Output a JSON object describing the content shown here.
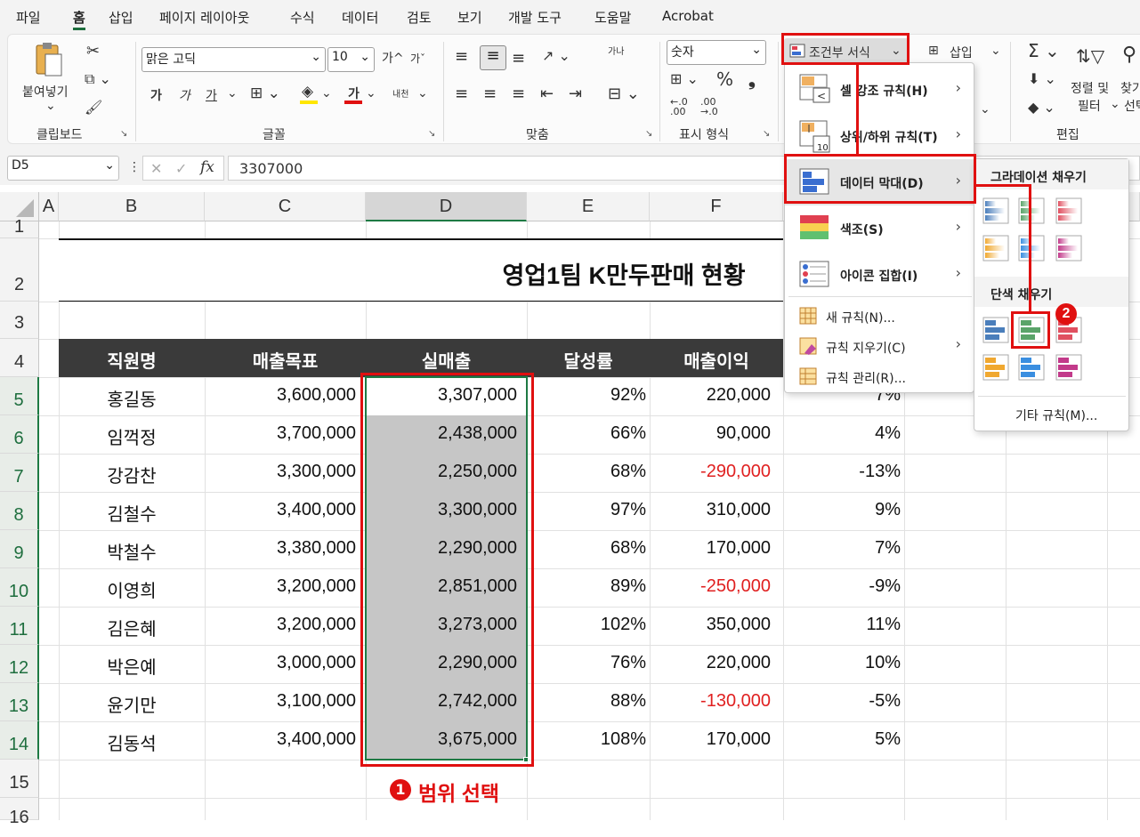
{
  "menubar": {
    "tabs": [
      "파일",
      "홈",
      "삽입",
      "페이지 레이아웃",
      "수식",
      "데이터",
      "검토",
      "보기",
      "개발 도구",
      "도움말",
      "Acrobat"
    ],
    "active": "홈"
  },
  "ribbon": {
    "clipboard": {
      "paste": "붙여넣기",
      "group": "클립보드"
    },
    "font": {
      "name": "맑은 고딕",
      "size": "10",
      "group": "글꼴",
      "bold": "가",
      "italic": "가",
      "underline": "가",
      "grow": "가^",
      "shrink": "가ˇ",
      "phonetic": "내천"
    },
    "align": {
      "group": "맞춤",
      "wrap": "가나"
    },
    "number": {
      "format": "숫자",
      "group": "표시 형식",
      "percent": "%",
      "comma": "❟"
    },
    "styles": {
      "cond_format": "조건부 서식"
    },
    "cells": {
      "insert": "삽입"
    },
    "editing": {
      "sort": "정렬 및",
      "filter": "필터",
      "find": "찾기",
      "select": "선택",
      "group": "편집"
    }
  },
  "formula_bar": {
    "namebox": "D5",
    "fx": "fx",
    "value": "3307000"
  },
  "columns": [
    "A",
    "B",
    "C",
    "D",
    "E",
    "F"
  ],
  "rows": [
    "1",
    "2",
    "3",
    "4",
    "5",
    "6",
    "7",
    "8",
    "9",
    "10",
    "11",
    "12",
    "13",
    "14",
    "15",
    "16"
  ],
  "sheet": {
    "title": "영업1팀 K만두판매 현황",
    "headers": [
      "직원명",
      "매출목표",
      "실매출",
      "달성률",
      "매출이익"
    ],
    "data": [
      [
        "홍길동",
        "3,600,000",
        "3,307,000",
        "92%",
        "220,000",
        "7%"
      ],
      [
        "임꺽정",
        "3,700,000",
        "2,438,000",
        "66%",
        "90,000",
        "4%"
      ],
      [
        "강감찬",
        "3,300,000",
        "2,250,000",
        "68%",
        "-290,000",
        "-13%"
      ],
      [
        "김철수",
        "3,400,000",
        "3,300,000",
        "97%",
        "310,000",
        "9%"
      ],
      [
        "박철수",
        "3,380,000",
        "2,290,000",
        "68%",
        "170,000",
        "7%"
      ],
      [
        "이영희",
        "3,200,000",
        "2,851,000",
        "89%",
        "-250,000",
        "-9%"
      ],
      [
        "김은혜",
        "3,200,000",
        "3,273,000",
        "102%",
        "350,000",
        "11%"
      ],
      [
        "박은예",
        "3,000,000",
        "2,290,000",
        "76%",
        "220,000",
        "10%"
      ],
      [
        "윤기만",
        "3,100,000",
        "2,742,000",
        "88%",
        "-130,000",
        "-5%"
      ],
      [
        "김동석",
        "3,400,000",
        "3,675,000",
        "108%",
        "170,000",
        "5%"
      ]
    ]
  },
  "cf_menu": {
    "items": [
      {
        "label": "셀 강조 규칙(H)"
      },
      {
        "label": "상위/하위 규칙(T)"
      },
      {
        "label": "데이터 막대(D)"
      },
      {
        "label": "색조(S)"
      },
      {
        "label": "아이콘 집합(I)"
      }
    ],
    "small": [
      {
        "label": "새 규칙(N)..."
      },
      {
        "label": "규칙 지우기(C)"
      },
      {
        "label": "규칙 관리(R)..."
      }
    ],
    "icon_badge": "10"
  },
  "databar_menu": {
    "gradient_title": "그라데이션 채우기",
    "solid_title": "단색 채우기",
    "more": "기타 규칙(M)...",
    "colors": [
      "#4a7ebb",
      "#5aa469",
      "#e05060",
      "#f0a830",
      "#3a8ee0",
      "#c23a8a"
    ]
  },
  "annotations": {
    "step1": "범위 선택",
    "step1_num": "1",
    "step2_num": "2"
  }
}
